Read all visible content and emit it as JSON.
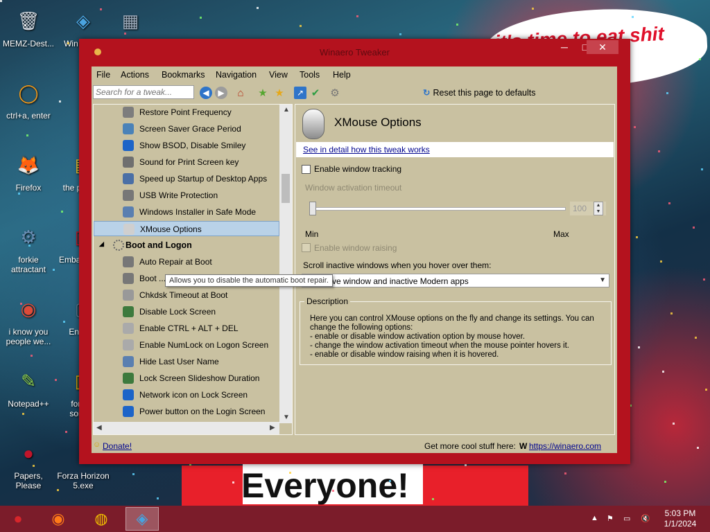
{
  "desktop": {
    "icons": [
      {
        "label": "MEMZ-Dest...",
        "glyph": "🗑",
        "color": "#cfd6de"
      },
      {
        "label": "ctrl+a, enter",
        "glyph": "◯",
        "color": "#f29a1b"
      },
      {
        "label": "Firefox",
        "glyph": "🦊",
        "color": "#e66000"
      },
      {
        "label": "forkie attractant",
        "glyph": "⚙",
        "color": "#6a8fb5"
      },
      {
        "label": "i know you people we...",
        "glyph": "◉",
        "color": "#dd4b39"
      },
      {
        "label": "Notepad++",
        "glyph": "✎",
        "color": "#8fd14f"
      },
      {
        "label": "Papers, Please",
        "glyph": "●",
        "color": "#c0152b"
      },
      {
        "label": "Win Twe...",
        "glyph": "◈",
        "color": "#4aa3df"
      },
      {
        "label": "",
        "glyph": "▦",
        "color": "#9aa8b8"
      },
      {
        "label": "the p... sl...",
        "glyph": "▤",
        "color": "#f0c430"
      },
      {
        "label": "Emba... Dev-",
        "glyph": "▣",
        "color": "#c81b26"
      },
      {
        "label": "Ender...",
        "glyph": "▢",
        "color": "#5e7d94"
      },
      {
        "label": "for w... some...",
        "glyph": "▥",
        "color": "#e0b000"
      },
      {
        "label": "Forza Horizon 5.exe",
        "glyph": "◐",
        "color": "#555"
      }
    ],
    "bubble_text": "it's time to eat shit\n...lebrate",
    "banner_text": "Everyone!"
  },
  "window": {
    "title": "Winaero Tweaker",
    "controls": {
      "min": "─",
      "max": "□",
      "close": "✕"
    },
    "menu": [
      "File",
      "Actions",
      "Bookmarks",
      "Navigation",
      "View",
      "Tools",
      "Help"
    ],
    "search_placeholder": "Search for a tweak...",
    "reset_label": "Reset this page to defaults",
    "tree": [
      {
        "label": "Restore Point Frequency",
        "kind": "item",
        "color": "#7d7d7d"
      },
      {
        "label": "Screen Saver Grace Period",
        "kind": "item",
        "color": "#4a82b8"
      },
      {
        "label": "Show BSOD, Disable Smiley",
        "kind": "item",
        "color": "#1c64c8"
      },
      {
        "label": "Sound for Print Screen key",
        "kind": "item",
        "color": "#6f6f6f"
      },
      {
        "label": "Speed up Startup of Desktop Apps",
        "kind": "item",
        "color": "#4a6fa6"
      },
      {
        "label": "USB Write Protection",
        "kind": "item",
        "color": "#777"
      },
      {
        "label": "Windows Installer in Safe Mode",
        "kind": "item",
        "color": "#5a7fb0"
      },
      {
        "label": "XMouse Options",
        "kind": "selected",
        "color": "#cfcfcf"
      },
      {
        "label": "Boot and Logon",
        "kind": "group",
        "color": "#666"
      },
      {
        "label": "Auto Repair at Boot",
        "kind": "item",
        "color": "#777"
      },
      {
        "label": "Boot ...",
        "kind": "item",
        "color": "#777"
      },
      {
        "label": "Chkdsk Timeout at Boot",
        "kind": "item",
        "color": "#999"
      },
      {
        "label": "Disable Lock Screen",
        "kind": "item",
        "color": "#3d7a3d"
      },
      {
        "label": "Enable CTRL + ALT + DEL",
        "kind": "item",
        "color": "#aaa"
      },
      {
        "label": "Enable NumLock on Logon Screen",
        "kind": "item",
        "color": "#aaa"
      },
      {
        "label": "Hide Last User Name",
        "kind": "item",
        "color": "#5a7fb0"
      },
      {
        "label": "Lock Screen Slideshow Duration",
        "kind": "item",
        "color": "#3d7a3d"
      },
      {
        "label": "Network icon on Lock Screen",
        "kind": "item",
        "color": "#1c64c8"
      },
      {
        "label": "Power button on the Login Screen",
        "kind": "item",
        "color": "#1c64c8"
      }
    ],
    "tooltip": "Allows you to disable the automatic boot repair.",
    "panel": {
      "title": "XMouse Options",
      "detail_link": "See in detail how this tweak works",
      "enable_tracking": "Enable window tracking",
      "activation_timeout_label": "Window activation timeout",
      "slider_value": "100",
      "slider_min": "Min",
      "slider_max": "Max",
      "enable_raising": "Enable window raising",
      "scroll_label": "Scroll inactive windows when you hover over them:",
      "scroll_value": "ctive window and inactive Modern apps",
      "description_legend": "Description",
      "description_text": "Here you can control XMouse options on the fly and change its settings. You can\nchange the following options:\n  - enable or disable window activation option by mouse hover.\n  - change the window activation timeout when the mouse pointer hovers it.\n  - enable or disable window raising when it is hovered."
    },
    "status": {
      "donate": "Donate!",
      "more": "Get more cool stuff here:",
      "url": "https://winaero.com"
    }
  },
  "taskbar": {
    "clock_time": "5:03 PM",
    "clock_date": "1/1/2024"
  }
}
